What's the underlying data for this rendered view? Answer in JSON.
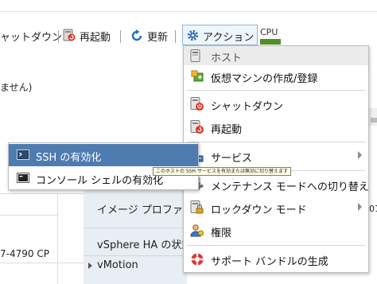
{
  "toolbar": {
    "shutdown_label": "ャットダウン",
    "restart_label": "再起動",
    "refresh_label": "更新",
    "actions_label": "アクション"
  },
  "summary": {
    "cpu_label": "CPU",
    "left_partial_text": "ません)",
    "cpu_model_partial": "7-4790 CP",
    "image_profile_label": "イメージ プロファ",
    "ha_state_label": "vSphere HA の状態",
    "vmotion_label": "vMotion",
    "partial_value_right": "01"
  },
  "menu": {
    "header": "ホスト",
    "items": [
      {
        "label": "仮想マシンの作成/登録",
        "icon": "new-vm-icon"
      },
      {
        "label": "シャットダウン",
        "icon": "shutdown-icon"
      },
      {
        "label": "再起動",
        "icon": "restart-icon"
      },
      {
        "label": "サービス",
        "icon": "services-icon",
        "has_submenu": true
      },
      {
        "label": "メンテナンス モードへの切り替え",
        "icon": "maintenance-mode-icon"
      },
      {
        "label": "ロックダウン モード",
        "icon": "lockdown-mode-icon",
        "has_submenu": true
      },
      {
        "label": "権限",
        "icon": "permissions-icon"
      },
      {
        "label": "サポート バンドルの生成",
        "icon": "support-bundle-icon"
      }
    ]
  },
  "submenu": {
    "items": [
      {
        "label": "SSH の有効化",
        "icon": "ssh-icon",
        "highlighted": true
      },
      {
        "label": "コンソール シェルの有効化",
        "icon": "console-shell-icon",
        "highlighted": false
      }
    ]
  },
  "tooltip": {
    "text": "このホストの SSH サービスを有効または無効に切り替えます"
  },
  "colors": {
    "highlight": "#4f7cb0",
    "cpu_bar": "#4f8f2a",
    "panel_bg": "#e8eef3"
  }
}
